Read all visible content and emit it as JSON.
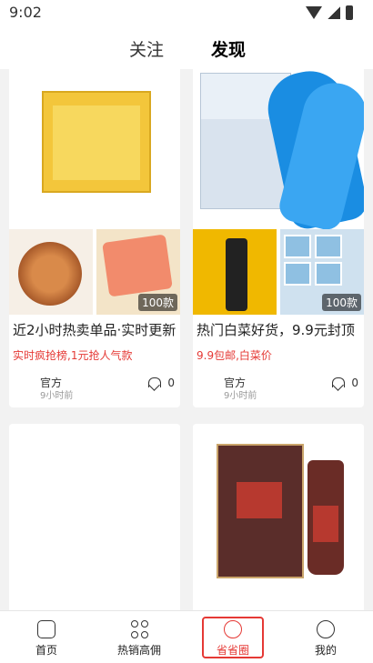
{
  "status": {
    "time": "9:02"
  },
  "tabs": {
    "follow": "关注",
    "discover": "发现"
  },
  "cards": [
    {
      "title": "近2小时热卖单品·实时更新",
      "promo": "实时疯抢榜,1元抢人气款",
      "author": "官方",
      "time": "9小时前",
      "likes": "0",
      "count": "100款"
    },
    {
      "title": "热门白菜好货，9.9元封顶",
      "promo": "9.9包邮,白菜价",
      "author": "官方",
      "time": "9小时前",
      "likes": "0",
      "count": "100款"
    }
  ],
  "nav": [
    {
      "label": "首页"
    },
    {
      "label": "热销高佣"
    },
    {
      "label": "省省圈"
    },
    {
      "label": "我的"
    }
  ]
}
